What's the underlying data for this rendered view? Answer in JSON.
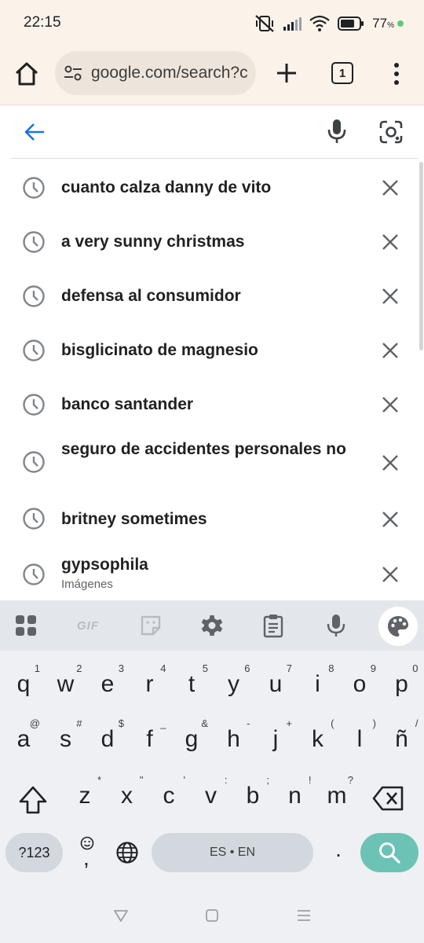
{
  "status_bar": {
    "time": "22:15",
    "battery_percent": "77",
    "battery_unit": "%",
    "icons": [
      "mute-vibrate-icon",
      "signal-icon",
      "wifi-icon",
      "battery-icon"
    ]
  },
  "toolbar": {
    "url": "google.com/search?c",
    "tab_count": "1",
    "icons": [
      "home-icon",
      "site-settings-icon",
      "plus-icon",
      "tab-switcher-icon",
      "more-menu-icon"
    ]
  },
  "search_box": {
    "value": "",
    "icons": [
      "back-arrow-icon",
      "microphone-icon",
      "google-lens-icon"
    ]
  },
  "suggestions": [
    {
      "text": "cuanto calza danny de vito",
      "subtext": ""
    },
    {
      "text": "a very sunny christmas",
      "subtext": ""
    },
    {
      "text": "defensa al consumidor",
      "subtext": ""
    },
    {
      "text": "bisglicinato de magnesio",
      "subtext": ""
    },
    {
      "text": "banco santander",
      "subtext": ""
    },
    {
      "text": "seguro de accidentes personales no",
      "subtext": ""
    },
    {
      "text": "britney sometimes",
      "subtext": ""
    },
    {
      "text": "gypsophila",
      "subtext": "Imágenes"
    }
  ],
  "keyboard": {
    "toolbar": {
      "gif_label": "GIF"
    },
    "rows": [
      [
        [
          "q",
          "1"
        ],
        [
          "w",
          "2"
        ],
        [
          "e",
          "3"
        ],
        [
          "r",
          "4"
        ],
        [
          "t",
          "5"
        ],
        [
          "y",
          "6"
        ],
        [
          "u",
          "7"
        ],
        [
          "i",
          "8"
        ],
        [
          "o",
          "9"
        ],
        [
          "p",
          "0"
        ]
      ],
      [
        [
          "a",
          "@"
        ],
        [
          "s",
          "#"
        ],
        [
          "d",
          "$"
        ],
        [
          "f",
          "_"
        ],
        [
          "g",
          "&"
        ],
        [
          "h",
          "-"
        ],
        [
          "j",
          "+"
        ],
        [
          "k",
          "("
        ],
        [
          "l",
          ")"
        ],
        [
          "ñ",
          "/"
        ]
      ],
      [
        [
          "z",
          "*"
        ],
        [
          "x",
          "\""
        ],
        [
          "c",
          "'"
        ],
        [
          "v",
          ":"
        ],
        [
          "b",
          ";"
        ],
        [
          "n",
          "!"
        ],
        [
          "m",
          "?"
        ]
      ]
    ],
    "symbols_label": "?123",
    "emoji_hint": ",",
    "space_label": "ES • EN",
    "period_label": ".",
    "accent_color": "#6cc3b5"
  },
  "nav_bar": {
    "icons": [
      "back-triangle-icon",
      "home-square-icon",
      "recents-menu-icon"
    ]
  }
}
